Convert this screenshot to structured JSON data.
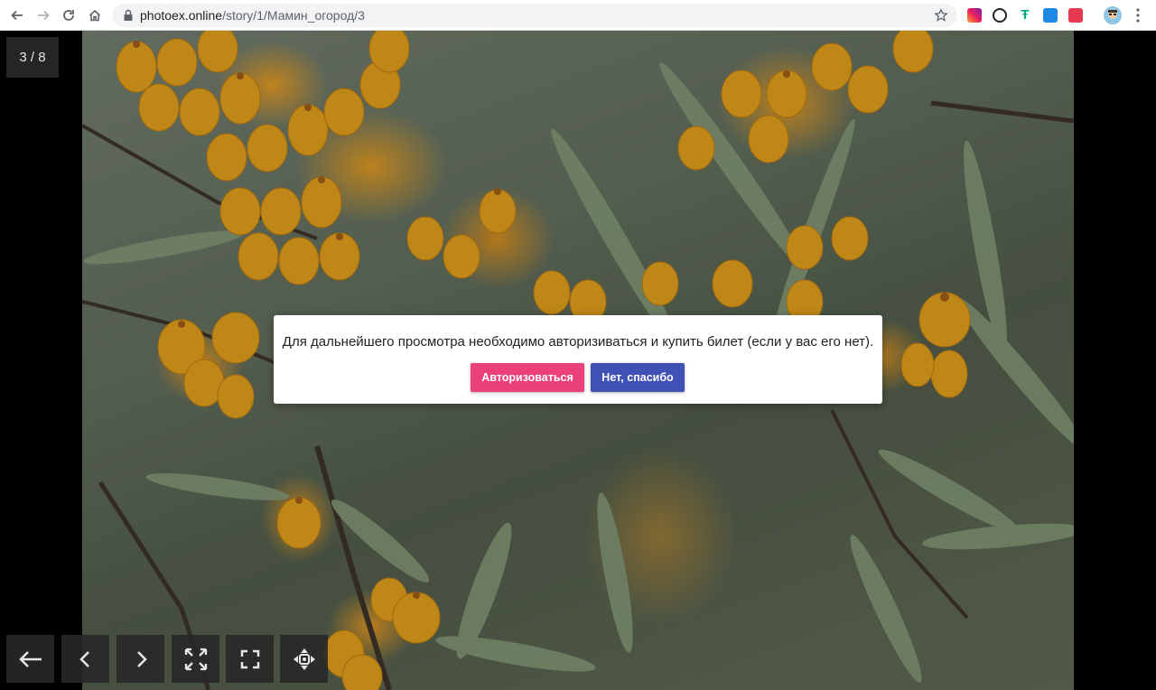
{
  "browser": {
    "url_host": "photoex.online",
    "url_path": "/story/1/Мамин_огород/3"
  },
  "viewer": {
    "counter": "3 / 8"
  },
  "modal": {
    "message": "Для дальнейшего просмотра необходимо авторизиваться и купить билет (если у вас его нет).",
    "login_label": "Авторизоваться",
    "decline_label": "Нет, спасибо",
    "login_color": "#ec407a",
    "decline_color": "#3f51b5"
  },
  "toolbar": {
    "icons": [
      "back-arrow-icon",
      "chevron-left-icon",
      "chevron-right-icon",
      "expand-icon",
      "fullscreen-icon",
      "move-icon"
    ]
  }
}
